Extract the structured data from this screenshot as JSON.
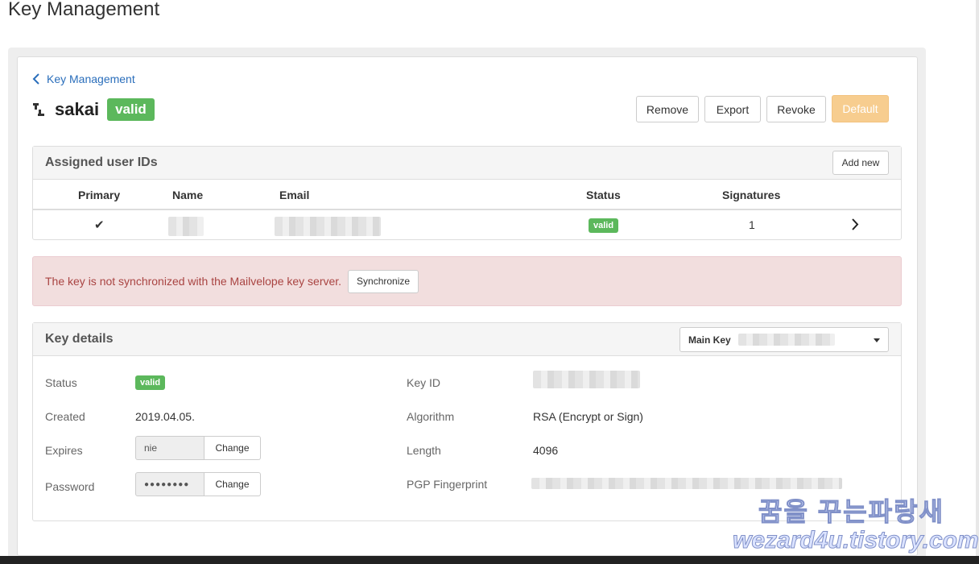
{
  "page": {
    "title": "Key Management"
  },
  "breadcrumb": {
    "back_label": "Key Management"
  },
  "key": {
    "name": "sakai",
    "status": "valid"
  },
  "actions": {
    "remove": "Remove",
    "export": "Export",
    "revoke": "Revoke",
    "default": "Default"
  },
  "user_ids": {
    "title": "Assigned user IDs",
    "add_new": "Add new",
    "columns": [
      "Primary",
      "Name",
      "Email",
      "Status",
      "Signatures"
    ],
    "rows": [
      {
        "primary": "✔",
        "status": "valid",
        "signatures": "1"
      }
    ]
  },
  "sync_alert": {
    "message": "The key is not synchronized with the Mailvelope key server.",
    "button": "Synchronize"
  },
  "details": {
    "title": "Key details",
    "selector_label": "Main Key",
    "status_label": "Status",
    "status_value": "valid",
    "created_label": "Created",
    "created_value": "2019.04.05.",
    "expires_label": "Expires",
    "expires_value": "nie",
    "expires_button": "Change",
    "password_label": "Password",
    "password_value": "●●●●●●●●",
    "password_button": "Change",
    "keyid_label": "Key ID",
    "algorithm_label": "Algorithm",
    "algorithm_value": "RSA (Encrypt or Sign)",
    "length_label": "Length",
    "length_value": "4096",
    "fingerprint_label": "PGP Fingerprint"
  },
  "watermark": {
    "line1": "꿈을 꾸는파랑새",
    "line2": "wezard4u.tistory.com"
  },
  "colors": {
    "valid": "#5cb85c",
    "link": "#2a6ebb",
    "alert_bg": "#f2dede",
    "alert_text": "#a94442",
    "default_btn": "#f7cd8f"
  }
}
